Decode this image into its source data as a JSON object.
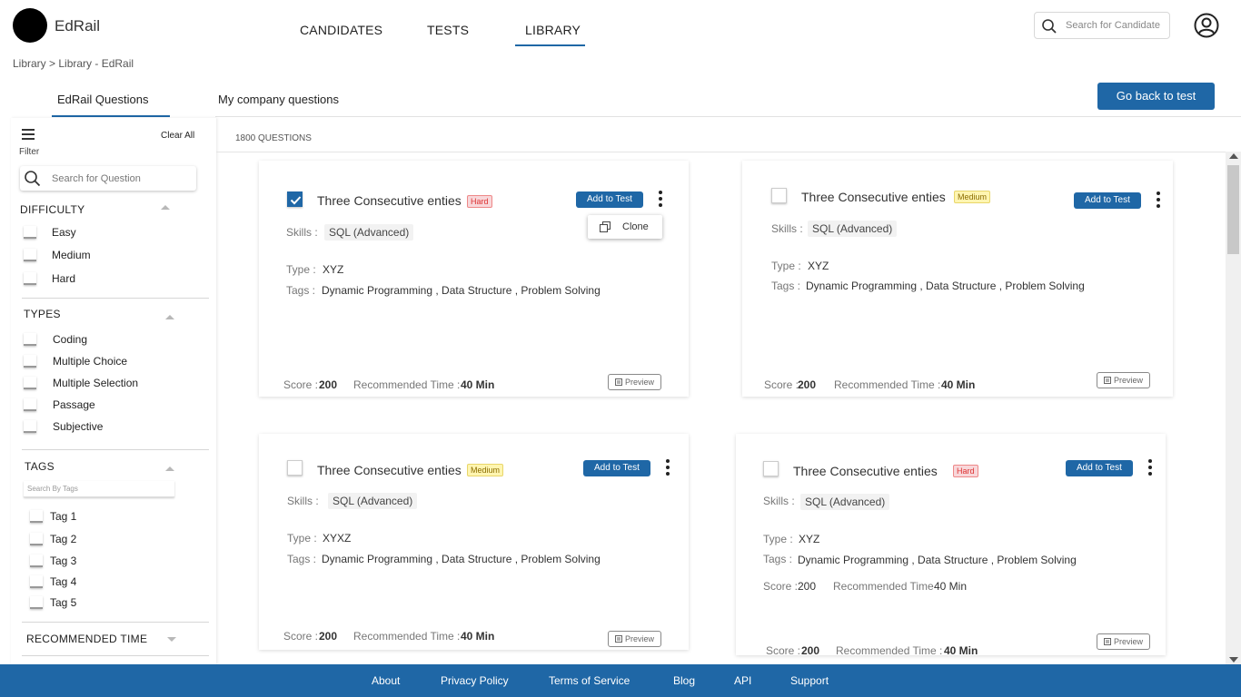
{
  "header": {
    "logo_text": "EdRail",
    "nav": [
      "CANDIDATES",
      "TESTS",
      "LIBRARY"
    ],
    "active_nav": "LIBRARY",
    "search_placeholder": "Search for Candidate",
    "breadcrumb": "Library > Library - EdRail"
  },
  "tabs": {
    "items": [
      "EdRail Questions",
      "My company questions"
    ],
    "active": "EdRail Questions",
    "back_button": "Go back to test"
  },
  "sidebar": {
    "filter_label": "Filter",
    "clear_all": "Clear All",
    "search_placeholder": "Search for Question",
    "difficulty": {
      "title": "DIFFICULTY",
      "options": [
        "Easy",
        "Medium",
        "Hard"
      ]
    },
    "types": {
      "title": "TYPES",
      "options": [
        "Coding",
        "Multiple Choice",
        "Multiple Selection",
        "Passage",
        "Subjective"
      ]
    },
    "tags": {
      "title": "TAGS",
      "search_placeholder": "Search By Tags",
      "options": [
        "Tag 1",
        "Tag 2",
        "Tag 3",
        "Tag 4",
        "Tag 5"
      ]
    },
    "recommended_time": {
      "title": "RECOMMENDED TIME"
    }
  },
  "main": {
    "count": "1800 QUESTIONS",
    "labels": {
      "skills": "Skills :",
      "type": "Type :",
      "tags": "Tags :",
      "score": "Score :",
      "recommended_time": "Recommended Time :",
      "recommended_time_nospace": "Recommended Time",
      "add_to_test": "Add to Test",
      "preview": "Preview",
      "clone": "Clone"
    },
    "cards": [
      {
        "title": "Three Consecutive enties",
        "difficulty": "Hard",
        "checked": true,
        "skill": "SQL (Advanced)",
        "type": "XYZ",
        "tags": "Dynamic Programming , Data Structure , Problem Solving",
        "score": "200",
        "time": "40 Min"
      },
      {
        "title": "Three Consecutive enties",
        "difficulty": "Medium",
        "checked": false,
        "skill": "SQL (Advanced)",
        "type": "XYZ",
        "tags": "Dynamic Programming , Data Structure , Problem Solving",
        "score": "200",
        "time": "40 Min"
      },
      {
        "title": "Three Consecutive enties",
        "difficulty": "Medium",
        "checked": false,
        "skill": "SQL (Advanced)",
        "type": "XYXZ",
        "tags": "Dynamic Programming , Data Structure , Problem Solving",
        "score": "200",
        "time": "40 Min"
      },
      {
        "title": "Three Consecutive enties",
        "difficulty": "Hard",
        "checked": false,
        "skill": "SQL (Advanced)",
        "type": "XYZ",
        "tags": "Dynamic Programming , Data Structure , Problem Solving",
        "score": "200",
        "time": "40 Min"
      }
    ]
  },
  "footer": {
    "links": [
      "About",
      "Privacy Policy",
      "Terms of Service",
      "Blog",
      "API",
      "Support"
    ]
  },
  "colors": {
    "primary": "#1f67a6",
    "hard_badge": "#f8d7da",
    "medium_badge": "#fff5b1"
  }
}
